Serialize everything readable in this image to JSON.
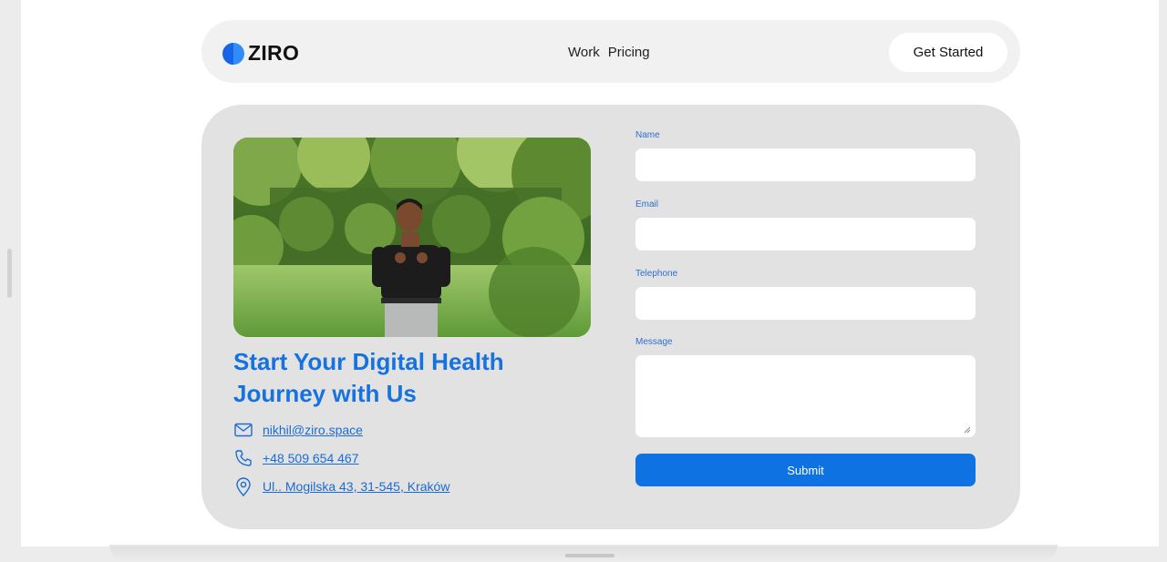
{
  "colors": {
    "accent": "#1672df",
    "button": "#0e72e3",
    "card": "#e2e2e2",
    "nav_bg": "#f1f1f1"
  },
  "nav": {
    "logo_icon": "half-filled-circle-icon",
    "logo_text": "ZIRO",
    "links": [
      "Work",
      "Pricing"
    ],
    "cta_label": "Get Started"
  },
  "hero": {
    "image_alt": "man-speaking-outdoors-photo",
    "headline": "Start Your Digital Health Journey with Us"
  },
  "contacts": [
    {
      "icon": "mail-icon",
      "text": "nikhil@ziro.space"
    },
    {
      "icon": "phone-icon",
      "text": "+48 509 654 467"
    },
    {
      "icon": "map-pin-icon",
      "text": "Ul.. Mogilska 43, 31-545, Kraków"
    }
  ],
  "form": {
    "name_label": "Name",
    "name_value": "",
    "email_label": "Email",
    "email_value": "",
    "telephone_label": "Telephone",
    "telephone_value": "",
    "message_label": "Message",
    "message_value": "",
    "submit_label": "Submit"
  }
}
